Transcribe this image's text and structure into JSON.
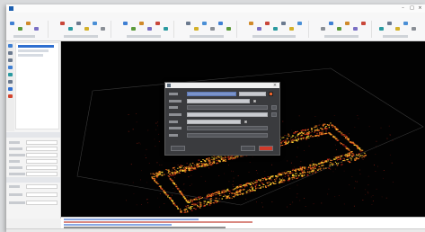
{
  "app": {
    "title": ""
  },
  "window_controls": [
    {
      "icon": "minimize-icon",
      "glyph": "–"
    },
    {
      "icon": "maximize-icon",
      "glyph": "□"
    },
    {
      "icon": "close-icon",
      "glyph": "×"
    }
  ],
  "menubar": {
    "items": [
      "",
      "",
      "",
      "",
      "",
      "",
      ""
    ]
  },
  "ribbon": {
    "tools": [
      {
        "icon": "open-file-icon",
        "label": ""
      },
      {
        "icon": "save-icon",
        "label": ""
      },
      {
        "icon": "import-icon",
        "label": ""
      },
      {
        "icon": "export-icon",
        "label": ""
      },
      {
        "icon": "point-cloud-icon",
        "label": ""
      },
      {
        "icon": "filter-icon",
        "label": ""
      },
      {
        "icon": "segment-icon",
        "label": ""
      },
      {
        "icon": "measure-icon",
        "label": ""
      },
      {
        "icon": "color-icon",
        "label": ""
      },
      {
        "icon": "settings-icon",
        "label": ""
      }
    ]
  },
  "left_panel": {
    "vertical_tools": [
      "select-icon",
      "pan-icon",
      "rotate-icon",
      "zoom-icon",
      "fit-view-icon",
      "layers-icon",
      "info-icon",
      "color-icon"
    ],
    "tree_items": [
      {
        "label": "",
        "selected": true
      },
      {
        "label": "",
        "selected": false
      },
      {
        "label": "",
        "selected": false
      }
    ],
    "properties": [
      {
        "label": "",
        "value": ""
      },
      {
        "label": "",
        "value": ""
      },
      {
        "label": "",
        "value": ""
      },
      {
        "label": "",
        "value": ""
      },
      {
        "label": "",
        "value": ""
      },
      {
        "label": "",
        "value": ""
      },
      {
        "label": "",
        "value": ""
      },
      {
        "label": "",
        "value": ""
      },
      {
        "label": "",
        "value": ""
      }
    ]
  },
  "dialog": {
    "title": "",
    "rows": [
      {
        "label": "",
        "value": ""
      },
      {
        "label": "",
        "value": ""
      },
      {
        "label": "",
        "value": ""
      },
      {
        "label": "",
        "value": ""
      },
      {
        "label": "",
        "value": ""
      },
      {
        "label": "",
        "value": ""
      },
      {
        "label": "",
        "value": ""
      }
    ],
    "buttons": [
      {
        "label": ""
      },
      {
        "label": ""
      },
      {
        "label": ""
      }
    ],
    "accent_colors": {
      "orange": "#e8612a",
      "blue": "#7a93c9",
      "red": "#d03a2a"
    }
  },
  "console": {
    "lines": [
      "",
      "",
      "",
      ""
    ]
  },
  "status": {
    "text": ""
  },
  "viewport": {
    "background": "#020202",
    "cloud_colors": [
      "#f0c830",
      "#e07020",
      "#c02818",
      "#7a1410"
    ]
  }
}
